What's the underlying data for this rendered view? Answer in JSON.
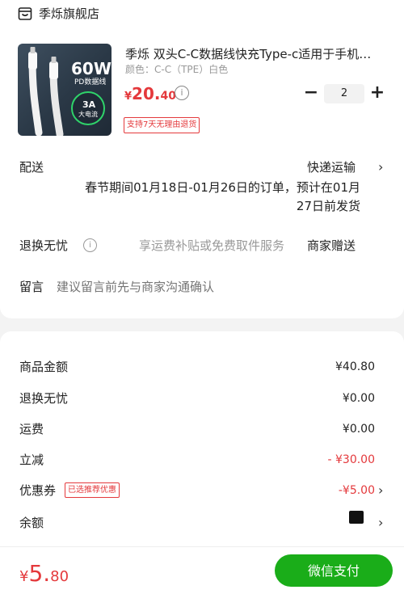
{
  "store": {
    "name": "季烁旗舰店",
    "icon": "store-icon"
  },
  "product": {
    "title": "季烁 双头C-C数据线快充Type-c适用于手机…",
    "variant": "颜色：C-C（TPE）白色",
    "price_currency": "¥",
    "price_int": "20.",
    "price_dec": "40",
    "quantity": "2",
    "return_tag": "支持7天无理由退货",
    "image_text": {
      "watt": "60W",
      "pd": "PD数据线",
      "amp": "3A",
      "current": "大电流"
    }
  },
  "shipping": {
    "label": "配送",
    "method": "快递运输",
    "notice": "春节期间01月18日-01月26日的订单，预计在01月27日前发货"
  },
  "after_sale": {
    "label": "退换无忧",
    "desc": "享运费补贴或免费取件服务",
    "value": "商家赠送"
  },
  "note": {
    "label": "留言",
    "placeholder": "建议留言前先与商家沟通确认"
  },
  "summary": {
    "goods_label": "商品金额",
    "goods_value": "¥40.80",
    "return_label": "退换无忧",
    "return_value": "¥0.00",
    "freight_label": "运费",
    "freight_value": "¥0.00",
    "discount_label": "立减",
    "discount_value": "- ¥30.00",
    "coupon_label": "优惠券",
    "coupon_tag": "已选推荐优惠",
    "coupon_value": "-¥5.00",
    "balance_label": "余额"
  },
  "footer": {
    "total_currency": "¥",
    "total_int": "5.",
    "total_dec": "80",
    "pay_label": "微信支付"
  },
  "colors": {
    "accent_red": "#e4393c",
    "pay_green": "#1aad19"
  }
}
